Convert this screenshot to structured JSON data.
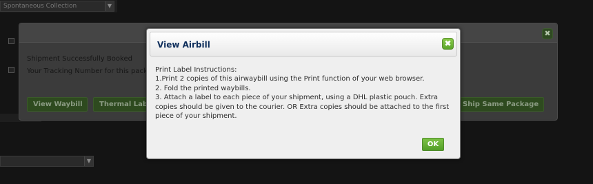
{
  "background": {
    "top_select_value": "Spontaneous Collection",
    "menu_item_1": "Ship Same Package"
  },
  "booking": {
    "close_glyph": "✖",
    "success_line": "Shipment Successfully Booked",
    "tracking_line": "Your Tracking Number for this package is",
    "buttons": {
      "view_waybill": "View Waybill",
      "thermal_label": "Thermal Label",
      "ship_same": "Ship Same Package"
    }
  },
  "modal": {
    "title": "View Airbill",
    "close_glyph": "✖",
    "instructions": {
      "heading": "Print Label Instructions:",
      "step1": "1.Print 2 copies of this airwaybill using the Print function of your web browser.",
      "step2": "2. Fold the printed waybills.",
      "step3": "3. Attach a label to each piece of your shipment, using a DHL plastic pouch. Extra copies should be given to the courier. OR Extra copies should be attached to the first piece of your shipment."
    },
    "ok_label": "OK"
  },
  "colors": {
    "accent_green": "#5aa52a",
    "title_blue": "#0f2f5c",
    "overlay": "#141414"
  }
}
